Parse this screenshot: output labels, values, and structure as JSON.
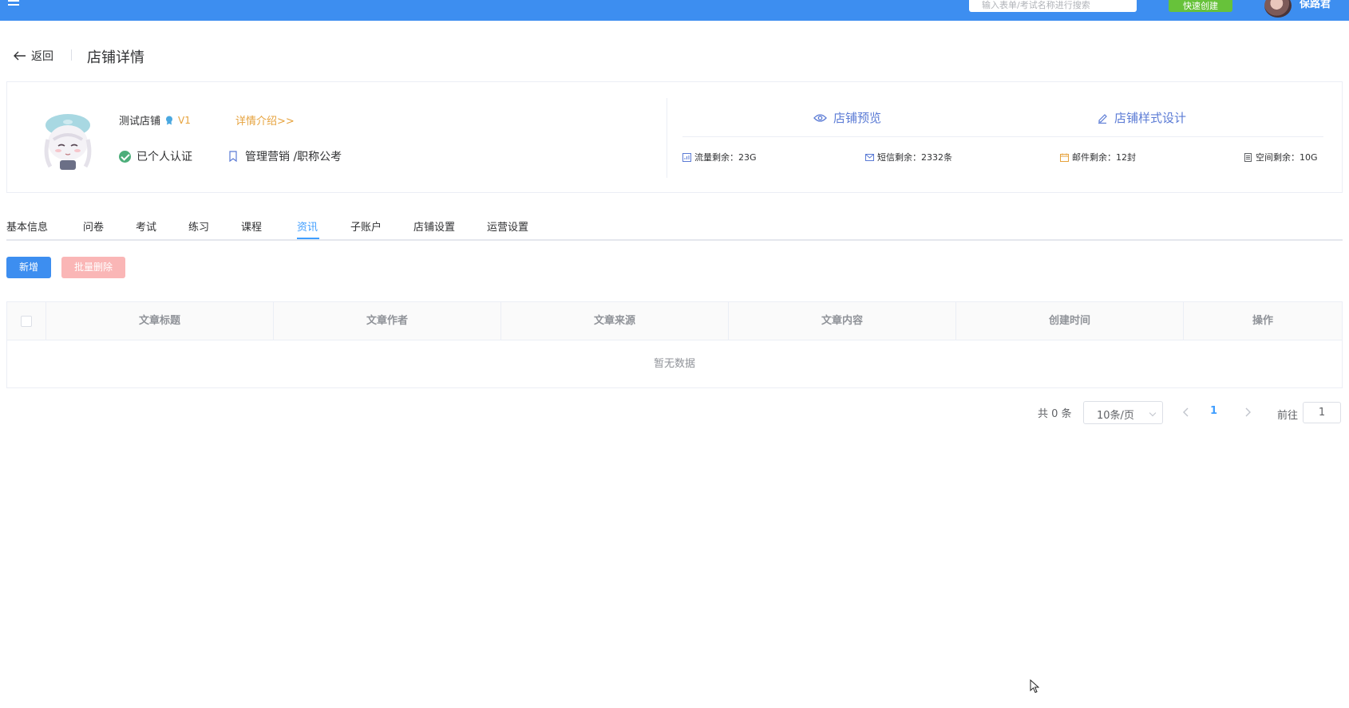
{
  "topbar": {
    "search_placeholder": "输入表单/考试名称进行搜索",
    "quick_create_label": "快速创建",
    "username": "保路君",
    "color": "#3d8ef0"
  },
  "header": {
    "back_label": "返回",
    "title": "店铺详情"
  },
  "shop": {
    "name": "测试店铺",
    "level": "V1",
    "detail_link": "详情介绍>>",
    "auth_status": "已个人认证",
    "category": "管理营销 /职称公考",
    "preview_label": "店铺预览",
    "design_label": "店铺样式设计",
    "quotas": {
      "traffic": "流量剩余：23G",
      "sms": "短信剩余：2332条",
      "mail": "邮件剩余：12封",
      "space": "空间剩余：10G"
    }
  },
  "tabs": [
    {
      "label": "基本信息"
    },
    {
      "label": "问卷"
    },
    {
      "label": "考试"
    },
    {
      "label": "练习"
    },
    {
      "label": "课程"
    },
    {
      "label": "资讯",
      "active": true
    },
    {
      "label": "子账户"
    },
    {
      "label": "店铺设置"
    },
    {
      "label": "运营设置"
    }
  ],
  "toolbar": {
    "add_label": "新增",
    "batch_delete_label": "批量删除"
  },
  "table": {
    "columns": [
      "文章标题",
      "文章作者",
      "文章来源",
      "文章内容",
      "创建时间",
      "操作"
    ],
    "empty_text": "暂无数据"
  },
  "pagination": {
    "total_text": "共 0 条",
    "page_size": "10条/页",
    "current_page": "1",
    "goto_label": "前往",
    "goto_value": "1"
  },
  "colors": {
    "primary": "#409eff",
    "success": "#67c23a",
    "warning": "#e6a23c",
    "danger_light": "#fab6b6"
  }
}
